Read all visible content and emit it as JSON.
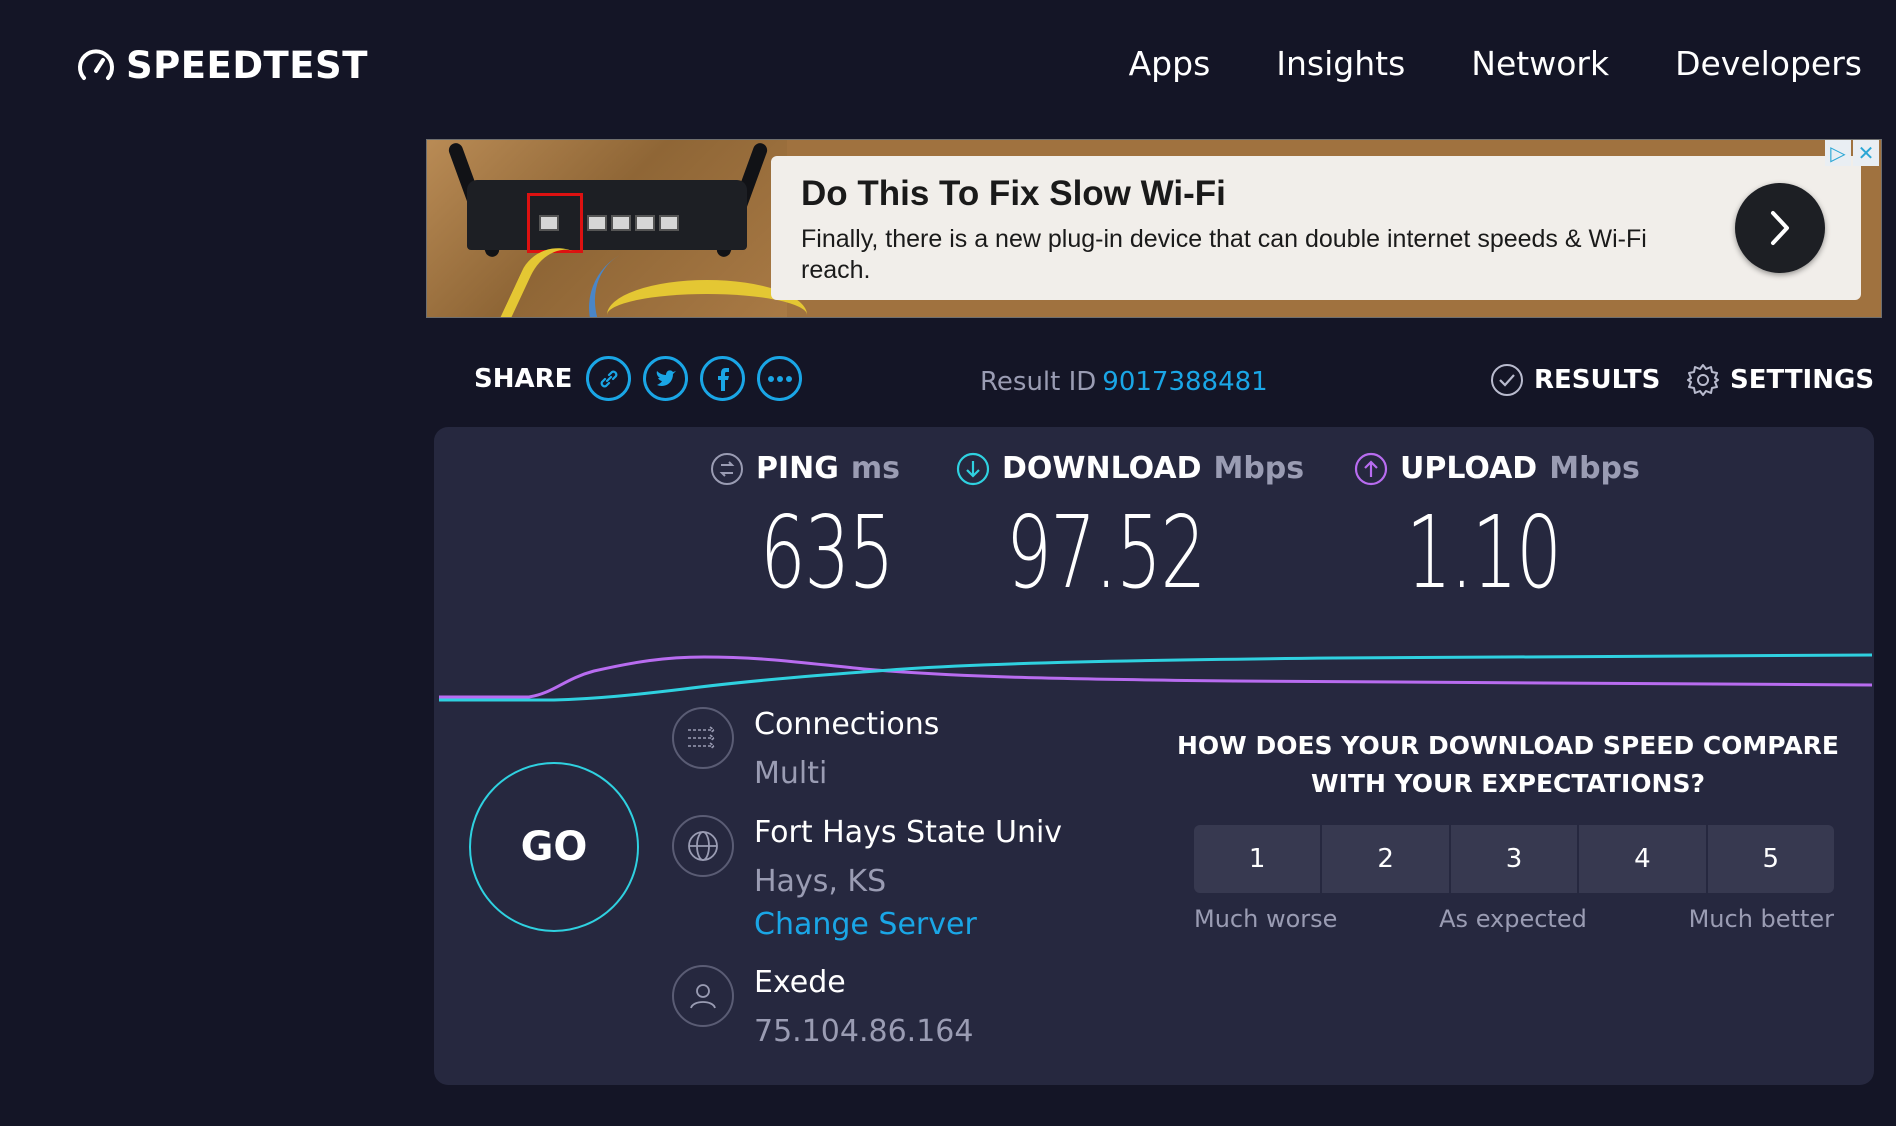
{
  "header": {
    "logo_text": "SPEEDTEST",
    "nav": [
      "Apps",
      "Insights",
      "Network",
      "Developers"
    ]
  },
  "ad": {
    "title": "Do This To Fix Slow Wi-Fi",
    "body": "Finally, there is a new plug-in device that can double internet speeds & Wi-Fi reach."
  },
  "share": {
    "label": "SHARE",
    "icons": [
      "link-icon",
      "twitter-icon",
      "facebook-icon",
      "more-icon"
    ]
  },
  "result": {
    "label": "Result ID",
    "id": "9017388481"
  },
  "actions": {
    "results_label": "RESULTS",
    "settings_label": "SETTINGS"
  },
  "metrics": {
    "ping": {
      "label": "PING",
      "unit": "ms",
      "value": "635",
      "color": "#ffffff"
    },
    "download": {
      "label": "DOWNLOAD",
      "unit": "Mbps",
      "value": "97.52",
      "color": "#2fd1e0"
    },
    "upload": {
      "label": "UPLOAD",
      "unit": "Mbps",
      "value": "1.10",
      "color": "#b86cf0"
    }
  },
  "go_label": "GO",
  "connections": {
    "title": "Connections",
    "value": "Multi"
  },
  "server": {
    "name": "Fort Hays State Univ",
    "location": "Hays, KS",
    "change_label": "Change Server"
  },
  "isp": {
    "name": "Exede",
    "ip": "75.104.86.164"
  },
  "survey": {
    "question": "HOW DOES YOUR DOWNLOAD SPEED COMPARE WITH YOUR EXPECTATIONS?",
    "options": [
      "1",
      "2",
      "3",
      "4",
      "5"
    ],
    "low_label": "Much worse",
    "mid_label": "As expected",
    "high_label": "Much better"
  },
  "colors": {
    "background": "#141526",
    "panel": "#26283f",
    "accent": "#1aa6e6",
    "download_line": "#2fd1e0",
    "upload_line": "#b86cf0"
  }
}
